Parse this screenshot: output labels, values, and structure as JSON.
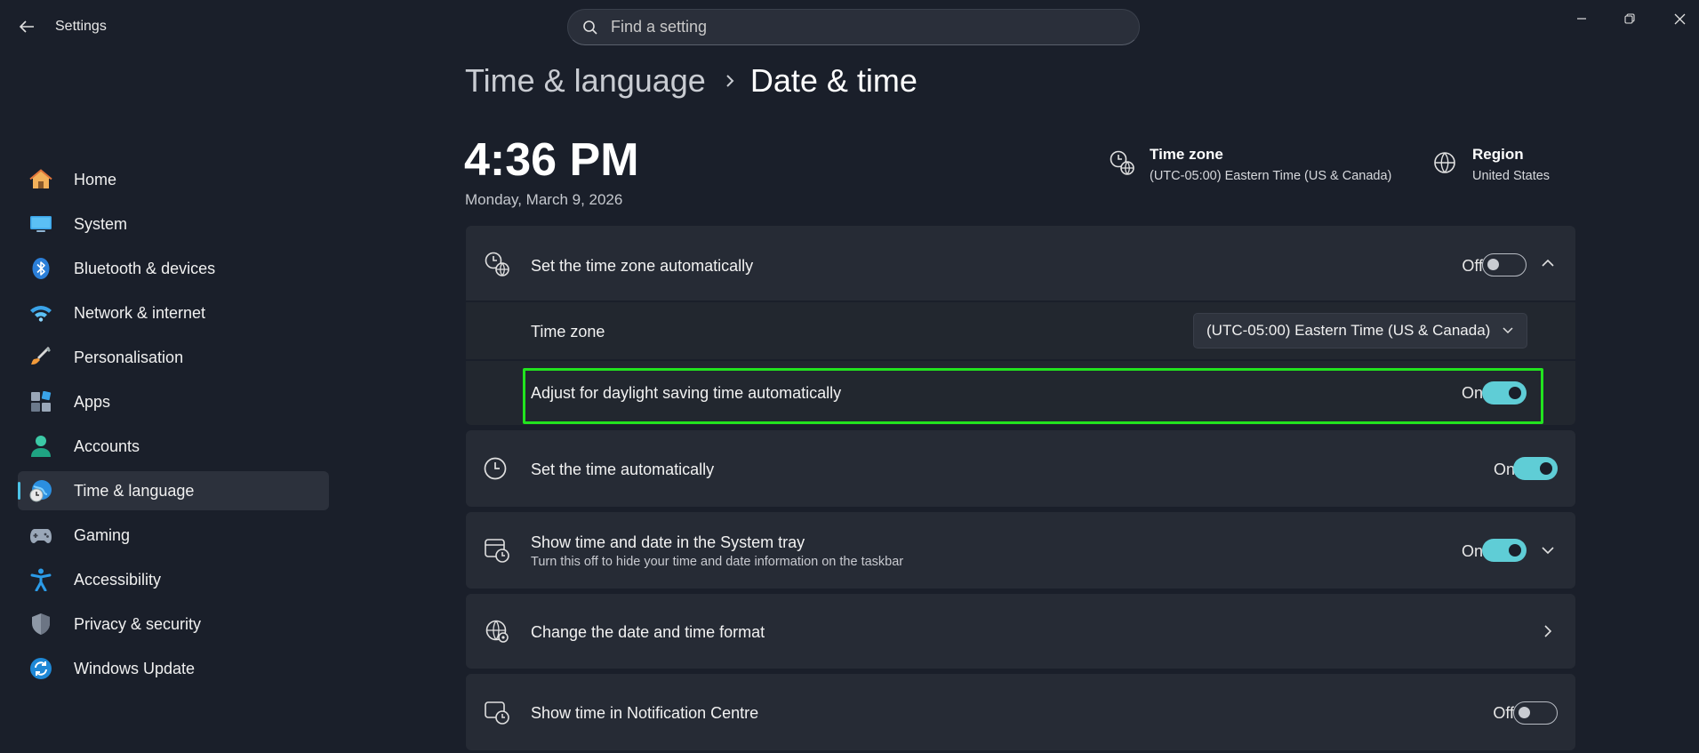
{
  "window": {
    "app_title": "Settings"
  },
  "search": {
    "placeholder": "Find a setting"
  },
  "sidebar": {
    "items": [
      {
        "label": "Home",
        "icon": "home-icon"
      },
      {
        "label": "System",
        "icon": "monitor-icon"
      },
      {
        "label": "Bluetooth & devices",
        "icon": "bluetooth-icon"
      },
      {
        "label": "Network & internet",
        "icon": "wifi-icon"
      },
      {
        "label": "Personalisation",
        "icon": "brush-icon"
      },
      {
        "label": "Apps",
        "icon": "apps-icon"
      },
      {
        "label": "Accounts",
        "icon": "person-icon"
      },
      {
        "label": "Time & language",
        "icon": "globe-clock-icon",
        "active": true
      },
      {
        "label": "Gaming",
        "icon": "gamepad-icon"
      },
      {
        "label": "Accessibility",
        "icon": "accessibility-icon"
      },
      {
        "label": "Privacy & security",
        "icon": "shield-icon"
      },
      {
        "label": "Windows Update",
        "icon": "update-icon"
      }
    ]
  },
  "breadcrumb": {
    "parent": "Time & language",
    "current": "Date & time"
  },
  "clock": {
    "time": "4:36 PM",
    "date": "Monday, March 9, 2026"
  },
  "header_info": {
    "timezone_title": "Time zone",
    "timezone_value": "(UTC-05:00) Eastern Time (US & Canada)",
    "region_title": "Region",
    "region_value": "United States"
  },
  "settings": {
    "auto_timezone": {
      "label": "Set the time zone automatically",
      "state": "Off"
    },
    "timezone": {
      "label": "Time zone",
      "value": "(UTC-05:00) Eastern Time (US & Canada)"
    },
    "daylight": {
      "label": "Adjust for daylight saving time automatically",
      "state": "On"
    },
    "auto_time": {
      "label": "Set the time automatically",
      "state": "On"
    },
    "tray": {
      "label": "Show time and date in the System tray",
      "desc": "Turn this off to hide your time and date information on the taskbar",
      "state": "On"
    },
    "format": {
      "label": "Change the date and time format"
    },
    "notification": {
      "label": "Show time in Notification Centre",
      "state": "Off"
    }
  },
  "colors": {
    "accent": "#5fcdd6",
    "highlight": "#22e41f",
    "background": "#1a1f2a"
  }
}
